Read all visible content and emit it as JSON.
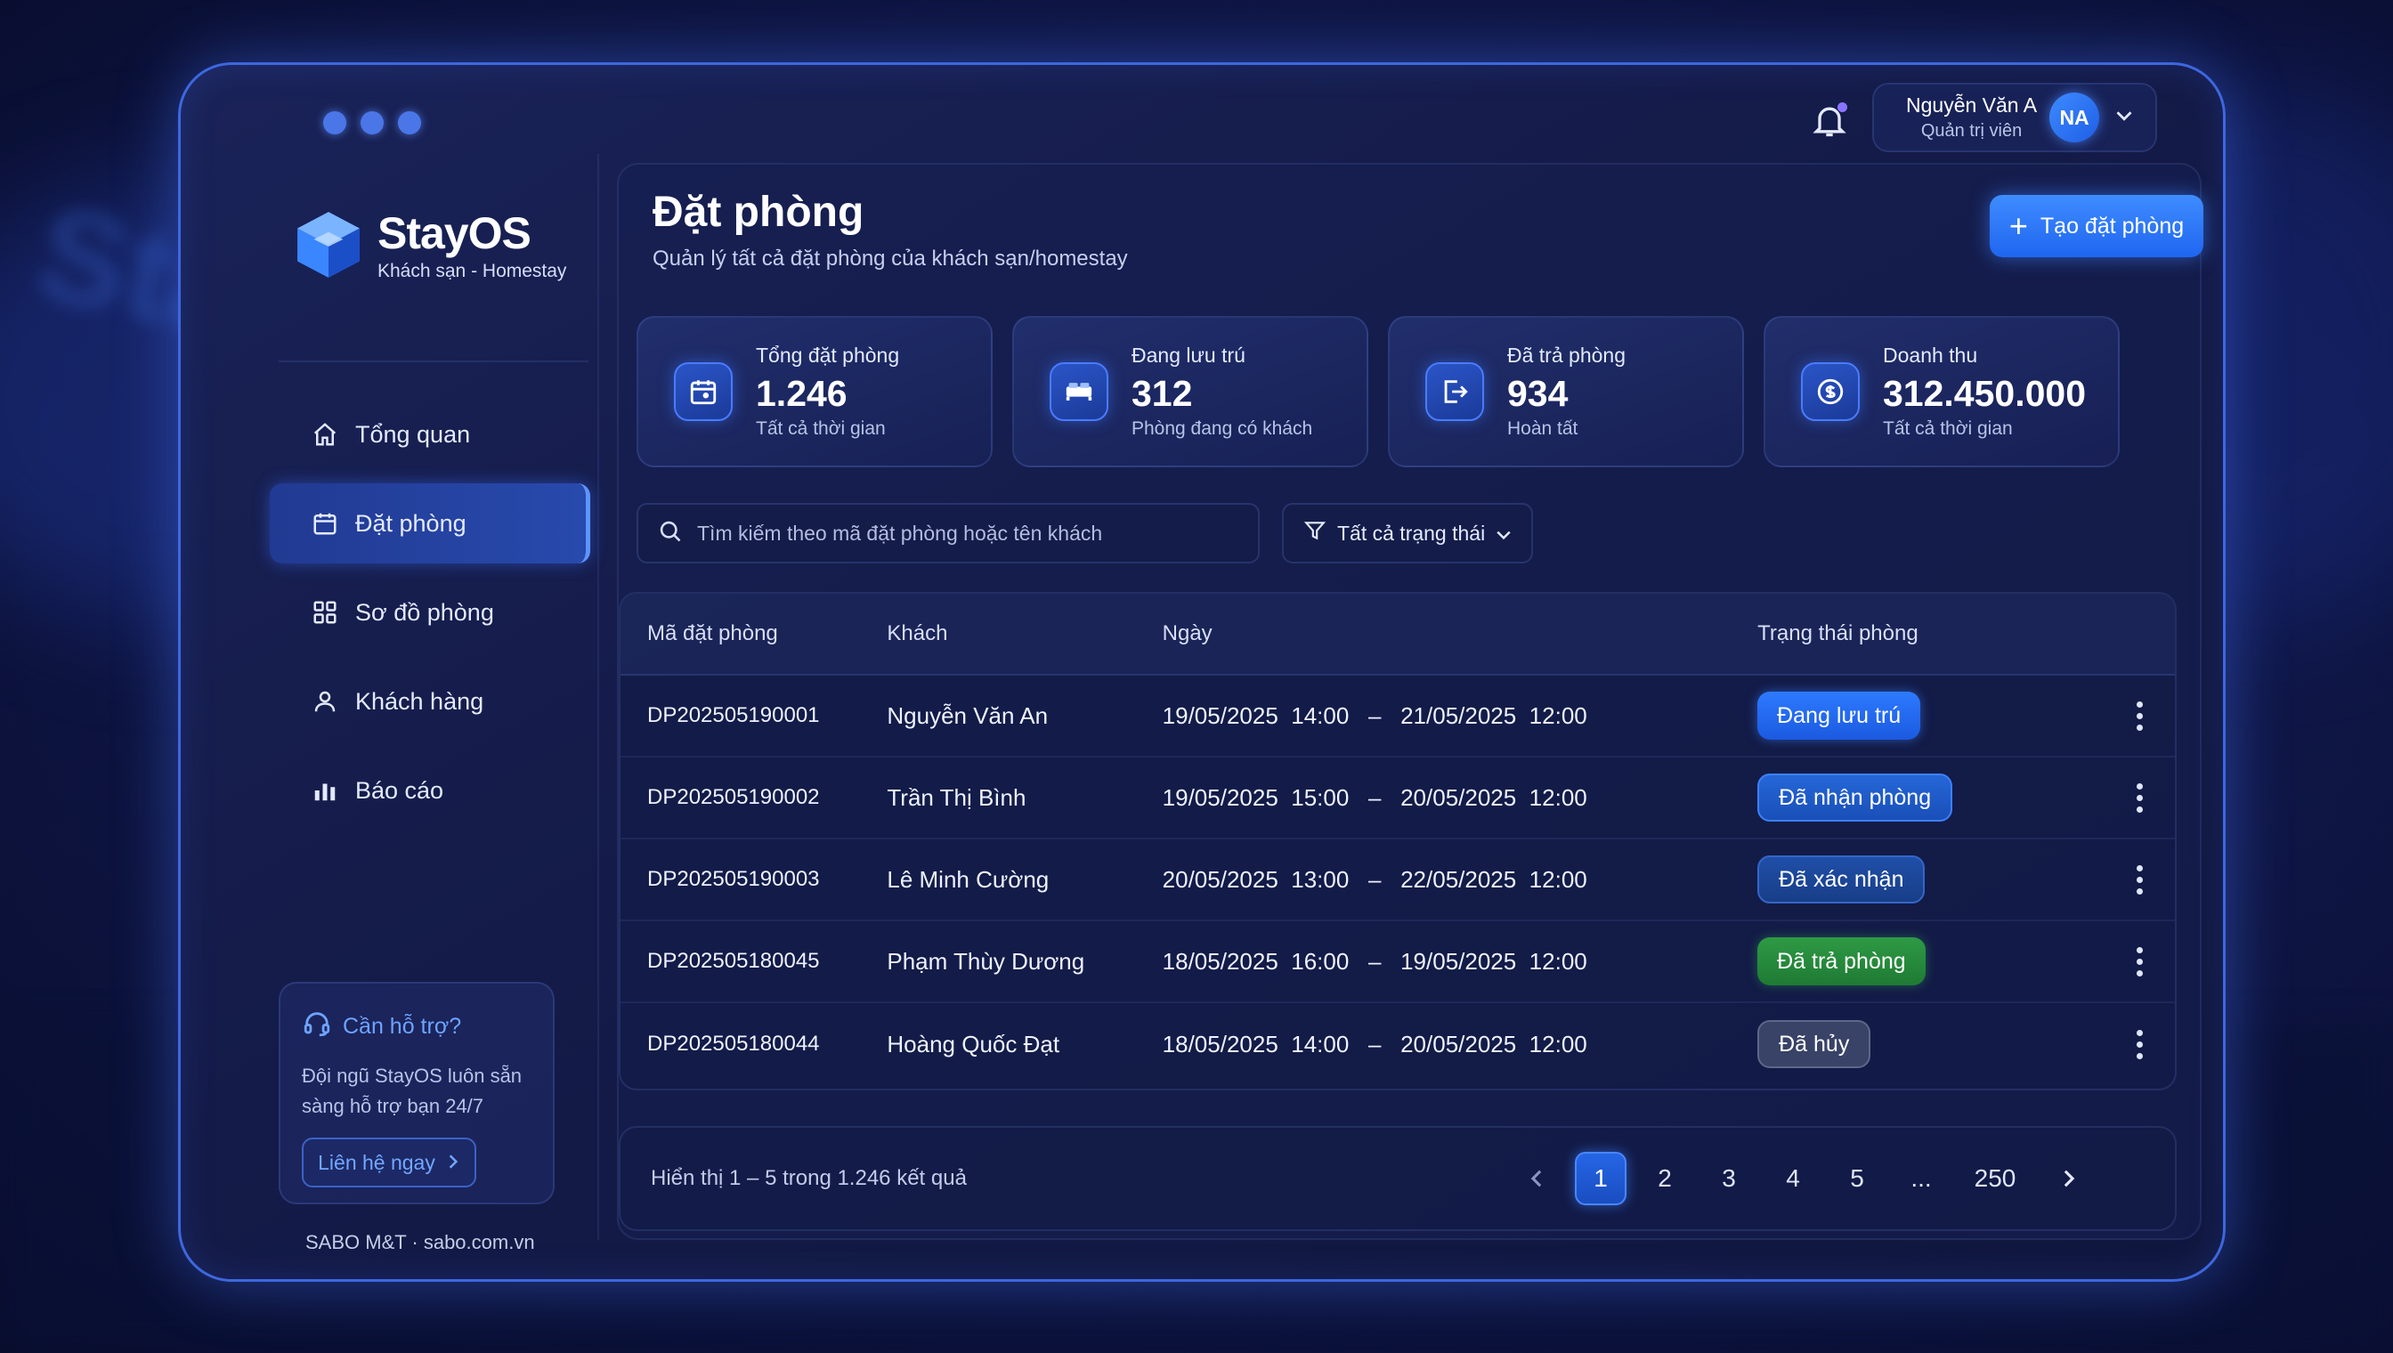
{
  "app": {
    "name": "StayOS",
    "tagline": "Khách sạn - Homestay",
    "footer": "SABO M&T · sabo.com.vn"
  },
  "sidebar": {
    "items": [
      {
        "label": "Tổng quan",
        "icon": "home-icon",
        "active": false
      },
      {
        "label": "Đặt phòng",
        "icon": "calendar-icon",
        "active": true
      },
      {
        "label": "Sơ đồ phòng",
        "icon": "grid-icon",
        "active": false
      },
      {
        "label": "Khách hàng",
        "icon": "user-icon",
        "active": false
      },
      {
        "label": "Báo cáo",
        "icon": "bar-chart-icon",
        "active": false
      }
    ],
    "help": {
      "title": "Cần hỗ trợ?",
      "text": "Đội ngũ StayOS luôn sẵn sàng hỗ trợ bạn 24/7",
      "button": "Liên hệ ngay"
    }
  },
  "topbar": {
    "user_name": "Nguyễn Văn A",
    "user_role": "Quản trị viên",
    "avatar_initials": "NA"
  },
  "page": {
    "title": "Đặt phòng",
    "subtitle": "Quản lý tất cả đặt phòng của khách sạn/homestay",
    "create_button": "Tạo đặt phòng"
  },
  "stats": [
    {
      "label": "Tổng đặt phòng",
      "value": "1.246",
      "sub": "Tất cả thời gian",
      "icon": "calendar-icon"
    },
    {
      "label": "Đang lưu trú",
      "value": "312",
      "sub": "Phòng đang có khách",
      "icon": "bed-icon"
    },
    {
      "label": "Đã trả phòng",
      "value": "934",
      "sub": "Hoàn tất",
      "icon": "checkout-icon"
    },
    {
      "label": "Doanh thu",
      "value": "312.450.000",
      "sub": "Tất cả thời gian",
      "icon": "revenue-icon"
    }
  ],
  "search": {
    "placeholder": "Tìm kiếm theo mã đặt phòng hoặc tên khách"
  },
  "filter": {
    "selected": "Tất cả trạng thái"
  },
  "table": {
    "columns": [
      "Mã đặt phòng",
      "Khách",
      "Ngày",
      "Trạng thái phòng"
    ],
    "rows": [
      {
        "code": "DP202505190001",
        "guest": "Nguyễn Văn An",
        "dates": "19/05/2025  14:00   –   21/05/2025  12:00",
        "status": "Đang lưu trú",
        "kind": "stay"
      },
      {
        "code": "DP202505190002",
        "guest": "Trần Thị Bình",
        "dates": "19/05/2025  15:00   –   20/05/2025  12:00",
        "status": "Đã nhận phòng",
        "kind": "check"
      },
      {
        "code": "DP202505190003",
        "guest": "Lê Minh Cường",
        "dates": "20/05/2025  13:00   –   22/05/2025  12:00",
        "status": "Đã xác nhận",
        "kind": "conf"
      },
      {
        "code": "DP202505180045",
        "guest": "Phạm Thùy Dương",
        "dates": "18/05/2025  16:00   –   19/05/2025  12:00",
        "status": "Đã trả phòng",
        "kind": "out"
      },
      {
        "code": "DP202505180044",
        "guest": "Hoàng Quốc Đạt",
        "dates": "18/05/2025  14:00   –   20/05/2025  12:00",
        "status": "Đã hủy",
        "kind": "cancel"
      }
    ]
  },
  "pagination": {
    "info": "Hiển thị 1 – 5 trong 1.246 kết quả",
    "pages": [
      "1",
      "2",
      "3",
      "4",
      "5",
      "...",
      "250"
    ],
    "current": "1"
  },
  "colors": {
    "accent": "#2d7aff",
    "success": "#2e9a44",
    "muted": "#5a6482"
  }
}
